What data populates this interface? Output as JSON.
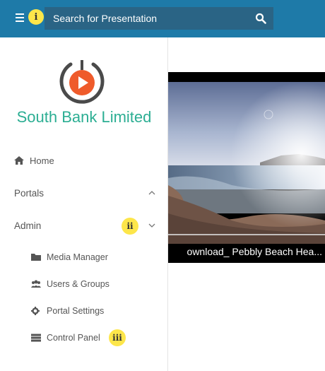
{
  "header": {
    "search_placeholder": "Search for Presentation",
    "markers": {
      "i": "i",
      "ii": "ii",
      "iii": "iii"
    }
  },
  "sidebar": {
    "brand": "South Bank Limited",
    "items": [
      {
        "label": "Home",
        "icon": "home-icon"
      },
      {
        "label": "Portals",
        "icon": "chevron-up-icon"
      },
      {
        "label": "Admin",
        "icon": "chevron-down-icon"
      }
    ],
    "admin_items": [
      {
        "label": "Media Manager",
        "icon": "folder-icon"
      },
      {
        "label": "Users & Groups",
        "icon": "users-icon"
      },
      {
        "label": "Portal Settings",
        "icon": "gear-icon"
      },
      {
        "label": "Control Panel",
        "icon": "server-icon"
      }
    ]
  },
  "video": {
    "title": "ownload_ Pebbly Beach Hea..."
  },
  "colors": {
    "topbar": "#1e7aa8",
    "search": "#2a6485",
    "brand": "#2cae93",
    "marker": "#fde64a",
    "logo_orange": "#ef5b2b"
  }
}
